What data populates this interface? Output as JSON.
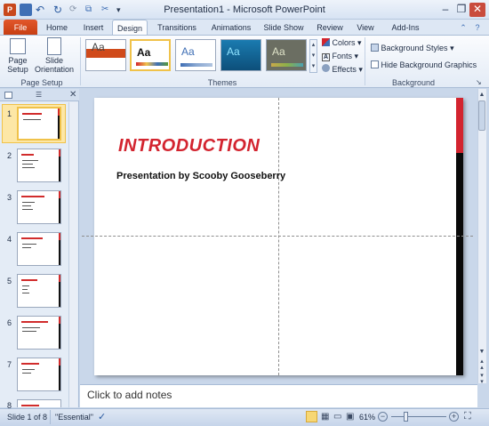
{
  "window": {
    "title": "Presentation1 - Microsoft PowerPoint"
  },
  "tabs": [
    "File",
    "Home",
    "Insert",
    "Design",
    "Transitions",
    "Animations",
    "Slide Show",
    "Review",
    "View",
    "Add-Ins"
  ],
  "active_tab": "Design",
  "ribbon": {
    "page_setup": {
      "label": "Page\nSetup",
      "orientation": "Slide\nOrientation",
      "group": "Page Setup"
    },
    "themes": {
      "group": "Themes",
      "aa": "Aa",
      "colors": "Colors",
      "fonts": "Fonts",
      "effects": "Effects"
    },
    "background": {
      "styles": "Background Styles",
      "hide": "Hide Background Graphics",
      "group": "Background"
    }
  },
  "slides": [
    "1",
    "2",
    "3",
    "4",
    "5",
    "6",
    "7",
    "8"
  ],
  "slide": {
    "title": "INTRODUCTION",
    "subtitle": "Presentation  by Scooby Gooseberry"
  },
  "notes_placeholder": "Click to add notes",
  "status": {
    "slide": "Slide 1 of 8",
    "theme": "\"Essential\"",
    "zoom": "61%"
  },
  "colors": {
    "accent": "#d3242f",
    "file_tab": "#d4491c",
    "selection": "#f0c24a"
  }
}
